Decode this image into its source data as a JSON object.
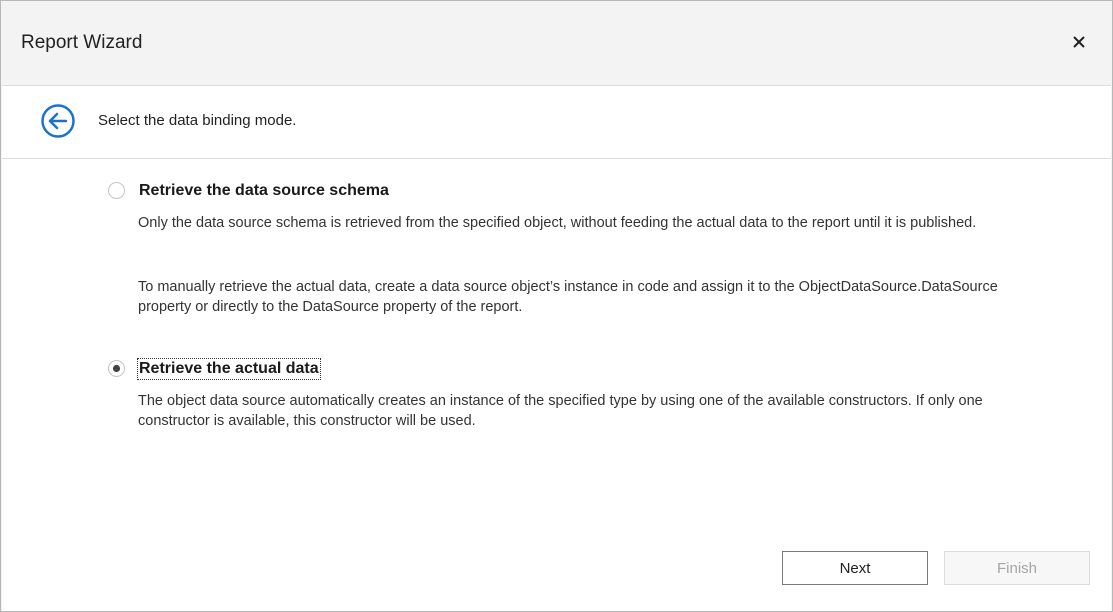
{
  "window": {
    "title": "Report Wizard"
  },
  "header": {
    "instruction": "Select the data binding mode."
  },
  "options": [
    {
      "label": "Retrieve the data source schema",
      "selected": false,
      "paragraphs": [
        "Only the data source schema is retrieved from the specified object, without feeding the actual data to the report until it is published.",
        "To manually retrieve the actual data, create a data source object’s instance in code and assign it to the ObjectDataSource.DataSource property or directly to the DataSource property of the report."
      ]
    },
    {
      "label": "Retrieve the actual data",
      "selected": true,
      "paragraphs": [
        "The object data source automatically creates an instance of the specified type by using one of the available constructors. If only one constructor is available, this constructor will be used."
      ]
    }
  ],
  "buttons": {
    "next_label": "Next",
    "finish_label": "Finish",
    "finish_enabled": false
  },
  "icons": {
    "back": "back-arrow-circle-icon",
    "close": "close-icon"
  },
  "colors": {
    "accent": "#1a73c9",
    "disabled_text": "#a5a5a5"
  }
}
